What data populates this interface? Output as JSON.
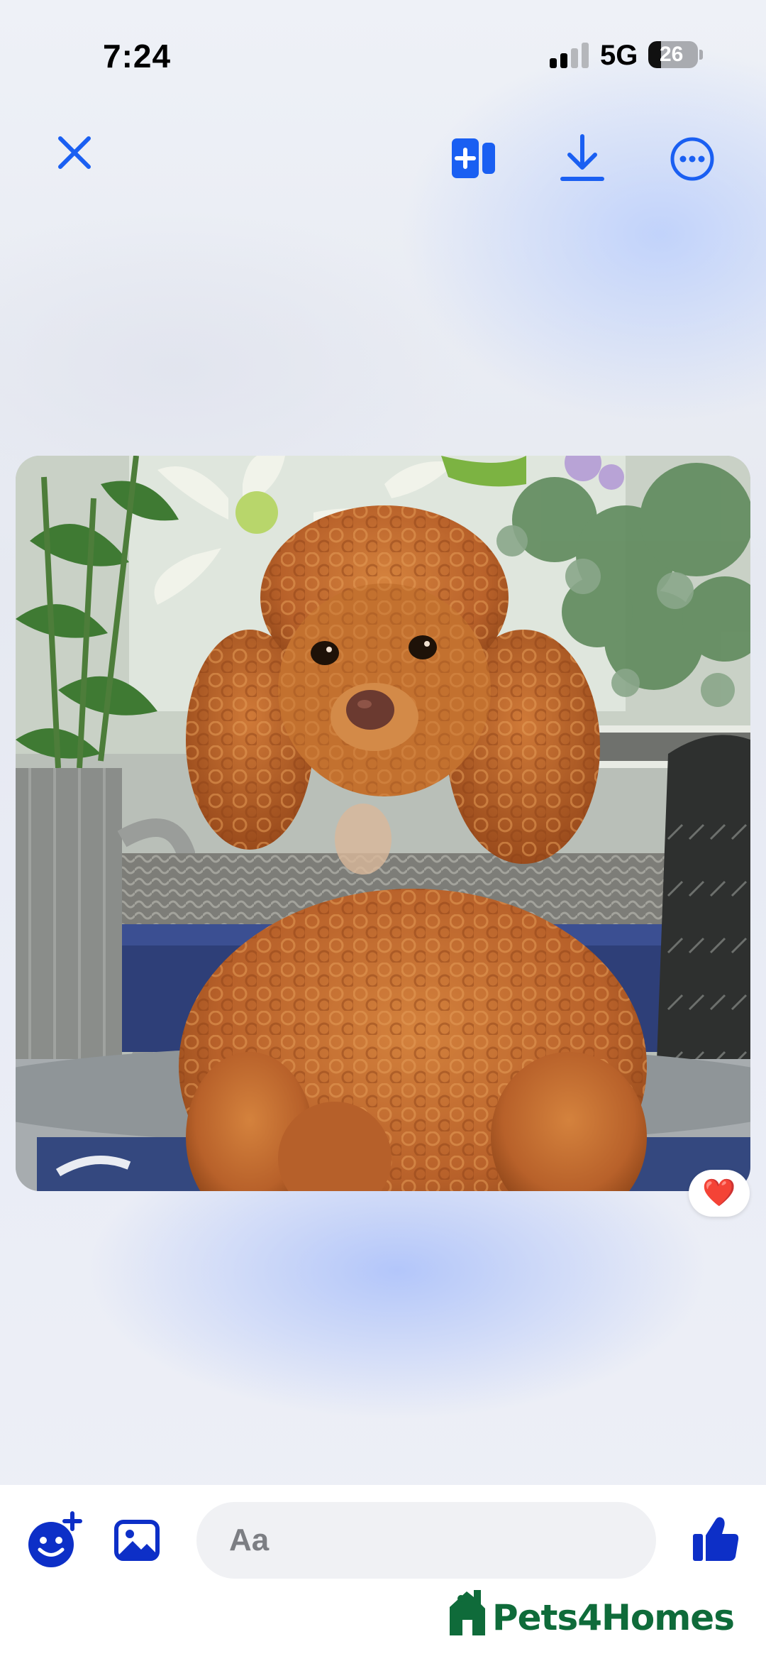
{
  "status_bar": {
    "time": "7:24",
    "network": "5G",
    "battery_level": "26"
  },
  "toolbar": {
    "close_icon": "close-icon",
    "compose_icon": "add-to-story-icon",
    "download_icon": "download-icon",
    "more_icon": "more-options-icon",
    "accent_color": "#1a5ff2"
  },
  "photo": {
    "subject": "red toy poodle",
    "reaction": "❤️"
  },
  "composer": {
    "placeholder": "Aa",
    "emoji_icon": "emoji-plus-icon",
    "gallery_icon": "gallery-icon",
    "like_icon": "thumbs-up-icon",
    "icon_color": "#0d2fc7"
  },
  "watermark": {
    "text": "Pets4Homes",
    "color": "#0f6b3a"
  }
}
